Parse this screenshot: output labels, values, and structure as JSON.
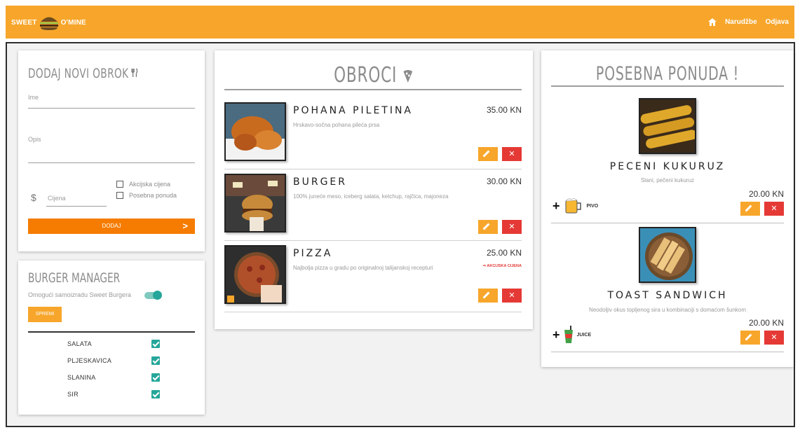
{
  "brand": {
    "left": "SWEET",
    "right": "O'MINE"
  },
  "nav": {
    "home_icon": "home-icon",
    "orders": "Narudžbe",
    "logout": "Odjava"
  },
  "add_meal": {
    "title": "DODAJ NOVI OBROK",
    "name_label": "Ime",
    "desc_label": "Opis",
    "price_label": "Cijena",
    "currency_symbol": "$",
    "checkbox_sale": "Akcijska cijena",
    "checkbox_special": "Posebna ponuda",
    "submit_label": "DODAJ"
  },
  "manager": {
    "title": "BURGER MANAGER",
    "toggle_label": "Omogući samoizradu Sweet Burgera",
    "save_label": "SPREMI",
    "ingredients": [
      {
        "name": "SALATA",
        "checked": true
      },
      {
        "name": "PLJESKAVICA",
        "checked": true
      },
      {
        "name": "SLANINA",
        "checked": true
      },
      {
        "name": "SIR",
        "checked": true
      }
    ]
  },
  "meals": {
    "title": "OBROCI",
    "items": [
      {
        "name": "POHANA PILETINA",
        "desc": "Hrskavo-sočna pohana pileća prsa",
        "price": "35.00 KN",
        "tag": ""
      },
      {
        "name": "BURGER",
        "desc": "100% juneće meso, iceberg salata, ketchup, rajčica, majoneza",
        "price": "30.00 KN",
        "tag": ""
      },
      {
        "name": "PIZZA",
        "desc": "Najbolja pizza u gradu po originalnoj talijanskoj recepturi",
        "price": "25.00 KN",
        "tag": "⇒ AKCIJSKA CIJENA"
      }
    ]
  },
  "offers": {
    "title": "POSEBNA PONUDA !",
    "items": [
      {
        "name": "PECENI KUKURUZ",
        "desc": "Slani, pečeni kukuruz",
        "price": "20.00 KN",
        "addon": "PIVO"
      },
      {
        "name": "TOAST SANDWICH",
        "desc": "Neodoljiv okus topljenog sira u kombinaciji s domaćom šunkom",
        "price": "20.00 KN",
        "addon": "JUICE"
      }
    ]
  },
  "colors": {
    "accent": "#f7a62b",
    "accent_dark": "#f57c00",
    "danger": "#e53935",
    "teal": "#26a69a"
  }
}
